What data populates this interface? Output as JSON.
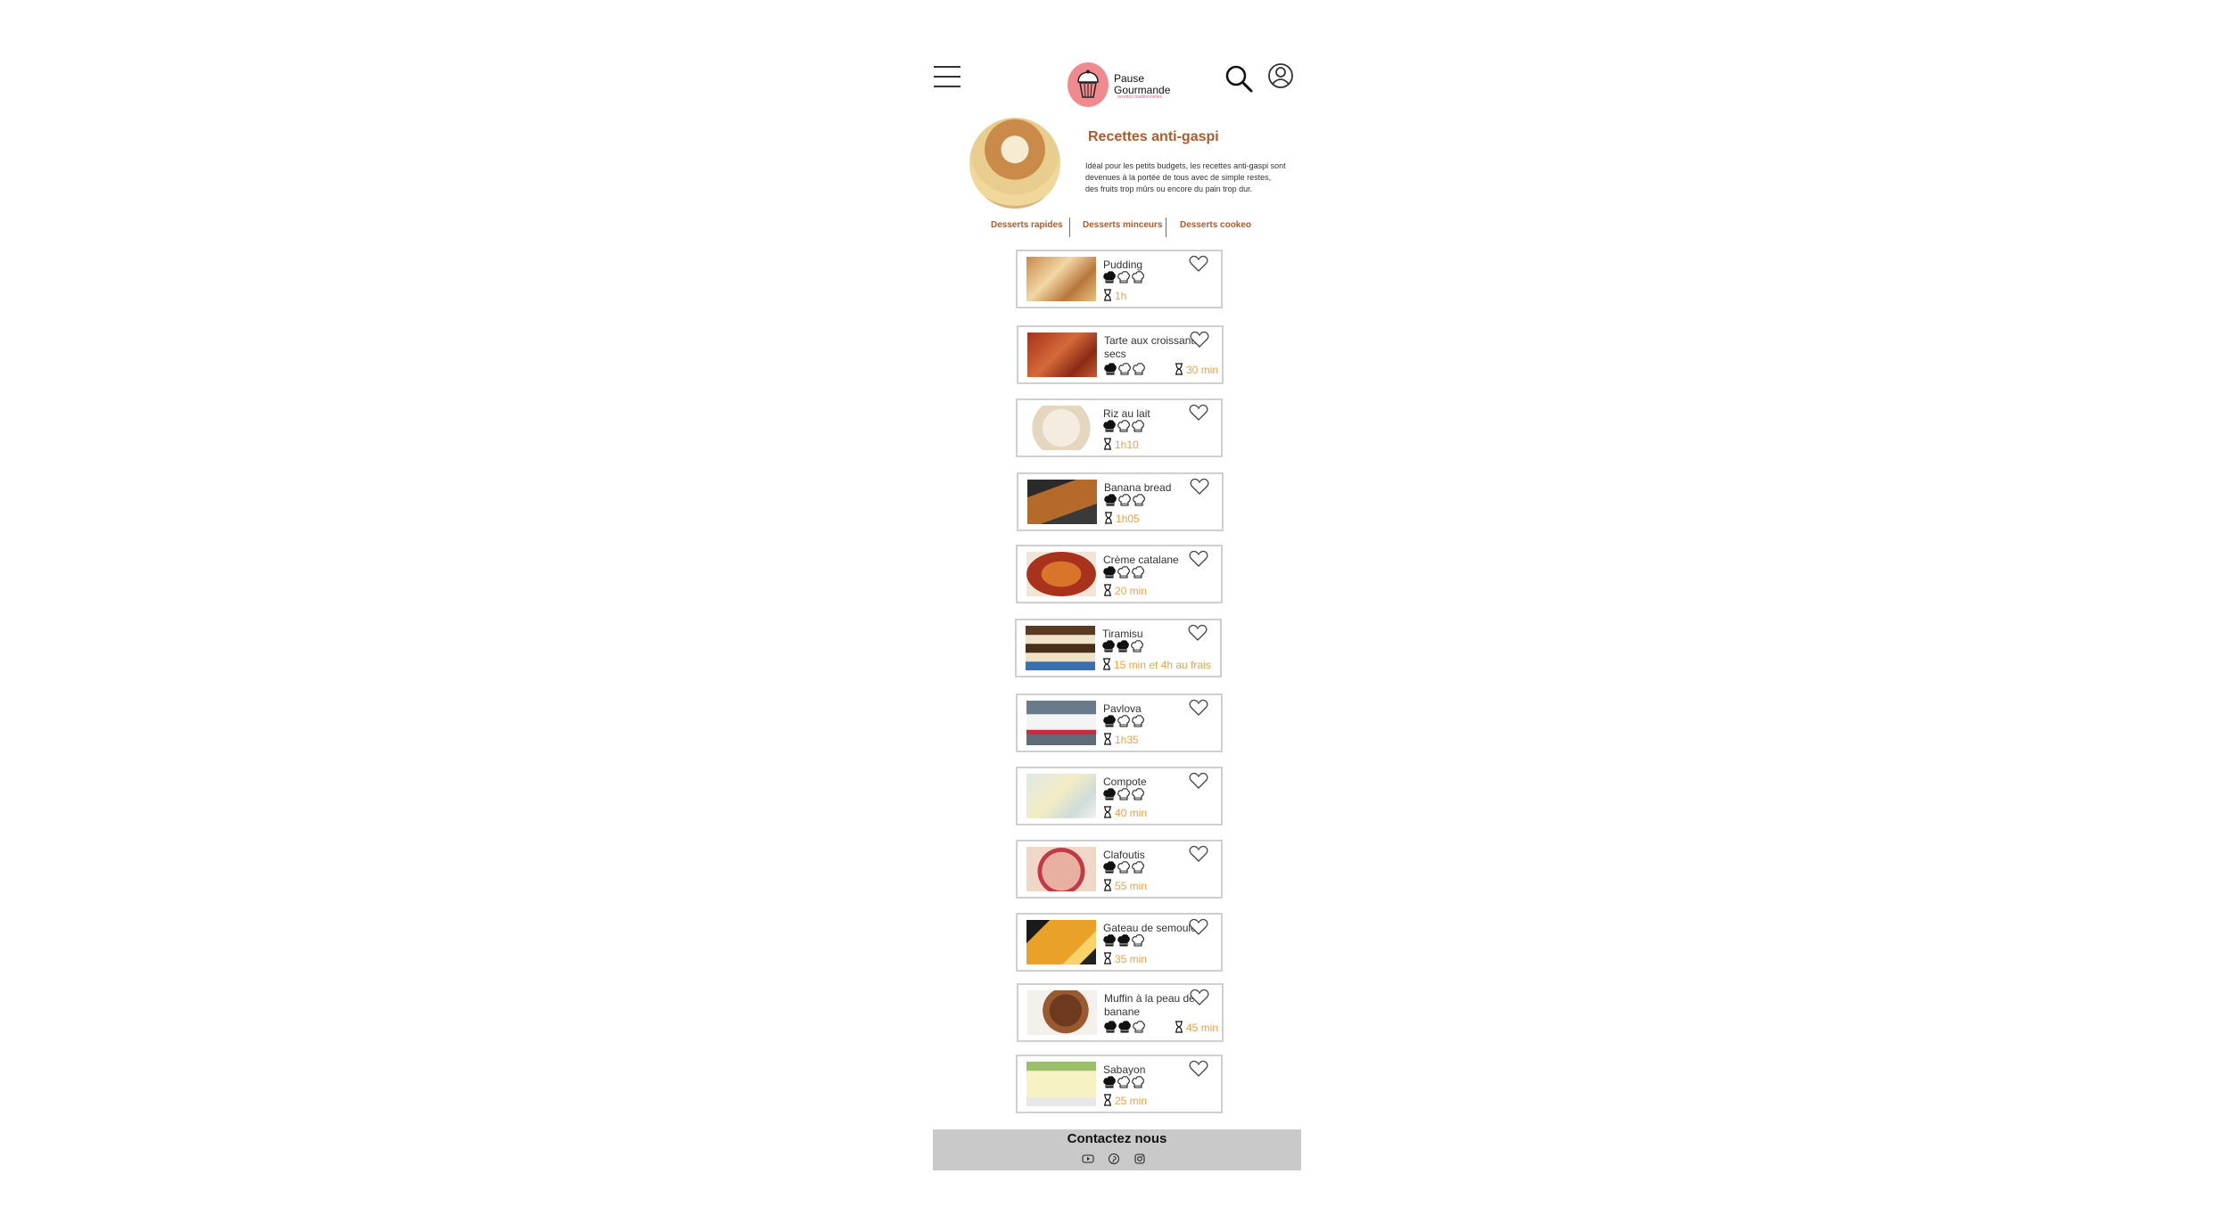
{
  "header": {
    "logo_name": "Pause Gourmande",
    "logo_tagline": "recettes traditionnelles"
  },
  "category": {
    "title": "Recettes anti-gaspi",
    "description": "Idéal pour les petits budgets, les recettes anti-gaspi sont devenues à la portée de tous avec de simple restes, des fruits trop mûrs ou encore du pain trop dur.",
    "links": [
      "Desserts rapides",
      "Desserts minceurs",
      "Desserts cookeo"
    ]
  },
  "recipes": [
    {
      "name": "Pudding",
      "difficulty": 1,
      "time": "1h",
      "image": "pudding"
    },
    {
      "name": "Tarte aux croissants secs",
      "difficulty": 1,
      "time": "30 min",
      "image": "tarte"
    },
    {
      "name": "Riz au lait",
      "difficulty": 1,
      "time": "1h10",
      "image": "riz"
    },
    {
      "name": "Banana bread",
      "difficulty": 1,
      "time": "1h05",
      "image": "banana"
    },
    {
      "name": "Crème catalane",
      "difficulty": 1,
      "time": "20 min",
      "image": "creme"
    },
    {
      "name": "Tiramisu",
      "difficulty": 2,
      "time": "15 min et 4h au frais",
      "image": "tiramisu"
    },
    {
      "name": "Pavlova",
      "difficulty": 1,
      "time": "1h35",
      "image": "pavlova"
    },
    {
      "name": "Compote",
      "difficulty": 1,
      "time": "40 min",
      "image": "compote"
    },
    {
      "name": "Clafoutis",
      "difficulty": 1,
      "time": "55 min",
      "image": "clafoutis"
    },
    {
      "name": "Gateau de semoule",
      "difficulty": 2,
      "time": "35 min",
      "image": "semoule"
    },
    {
      "name": "Muffin à la peau de banane",
      "difficulty": 2,
      "time": "45 min",
      "image": "muffin"
    },
    {
      "name": "Sabayon",
      "difficulty": 1,
      "time": "25 min",
      "image": "sabayon"
    }
  ],
  "footer": {
    "title": "Contactez nous",
    "social": [
      "youtube-icon",
      "pinterest-icon",
      "instagram-icon"
    ]
  },
  "colors": {
    "accent": "#b05a2a",
    "time": "#f0a040",
    "logo": "#f08a8e",
    "footer_bg": "#c9c9c9"
  }
}
